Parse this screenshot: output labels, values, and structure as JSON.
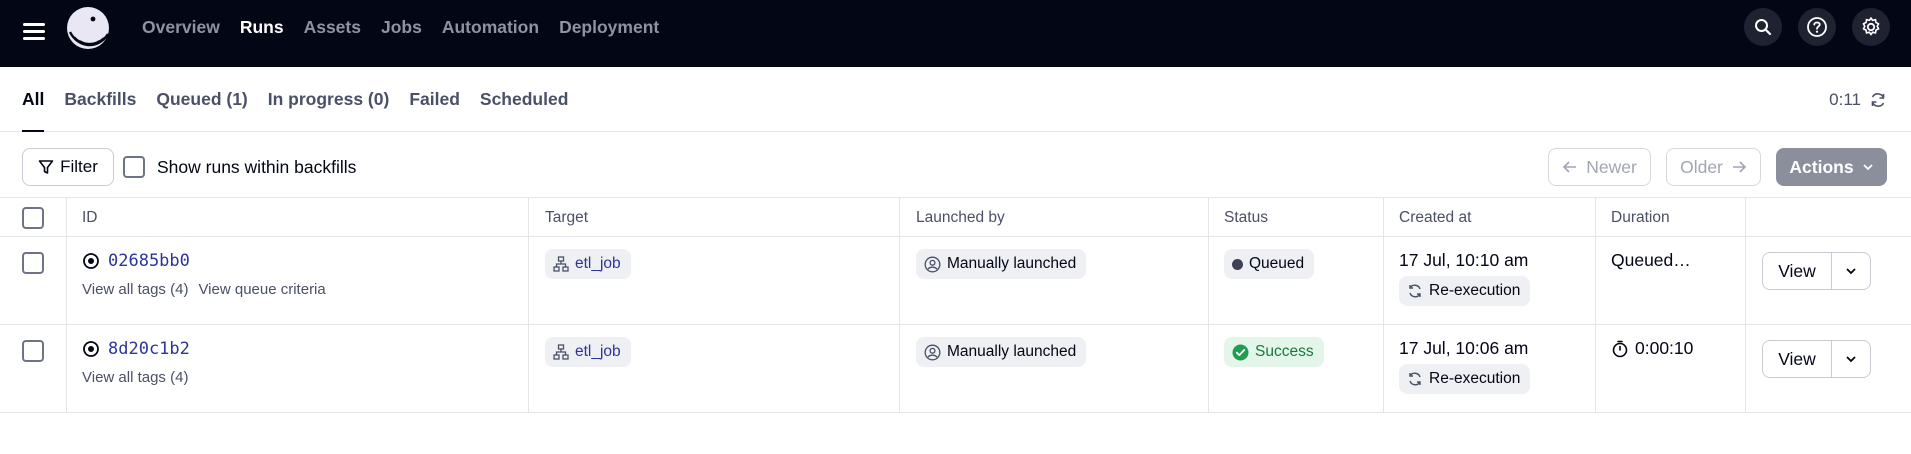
{
  "topnav": {
    "items": [
      "Overview",
      "Runs",
      "Assets",
      "Jobs",
      "Automation",
      "Deployment"
    ],
    "active": "Runs",
    "icons": [
      "search-icon",
      "help-icon",
      "gear-icon"
    ]
  },
  "tabs": {
    "items": [
      "All",
      "Backfills",
      "Queued (1)",
      "In progress (0)",
      "Failed",
      "Scheduled"
    ],
    "active": "All",
    "refresh_time": "0:11"
  },
  "toolbar": {
    "filter_label": "Filter",
    "show_backfills_label": "Show runs within backfills",
    "newer_label": "Newer",
    "older_label": "Older",
    "actions_label": "Actions"
  },
  "table": {
    "columns": [
      "ID",
      "Target",
      "Launched by",
      "Status",
      "Created at",
      "Duration"
    ],
    "rows": [
      {
        "id": "02685bb0",
        "tags_link": "View all tags (4)",
        "queue_link": "View queue criteria",
        "target": "etl_job",
        "launched_by": "Manually launched",
        "status": "Queued",
        "created_at": "17 Jul, 10:10 am",
        "created_tag": "Re-execution",
        "duration": "Queued…",
        "view_label": "View"
      },
      {
        "id": "8d20c1b2",
        "tags_link": "View all tags (4)",
        "target": "etl_job",
        "launched_by": "Manually launched",
        "status": "Success",
        "created_at": "17 Jul, 10:06 am",
        "created_tag": "Re-execution",
        "duration": "0:00:10",
        "view_label": "View"
      }
    ]
  },
  "colors": {
    "topbar_bg": "#030615",
    "link_blue": "#2d3596",
    "success_green": "#167a3c",
    "actions_bg": "#8b8f9b"
  }
}
